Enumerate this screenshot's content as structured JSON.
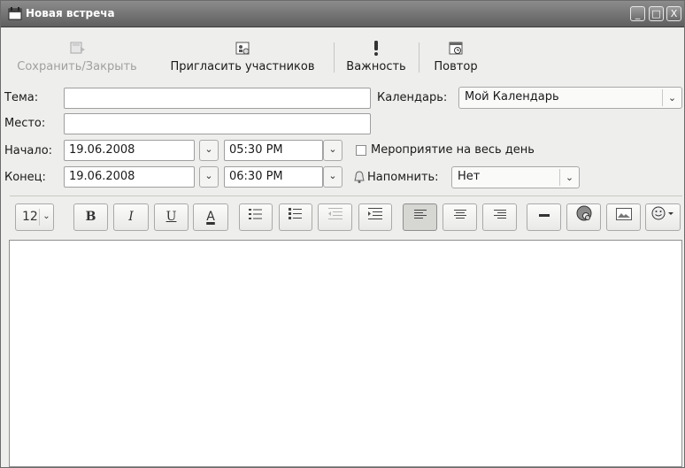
{
  "window": {
    "title": "Новая встреча",
    "controls": [
      "_",
      "□",
      "X"
    ]
  },
  "toolbar": {
    "save_close": "Сохранить/Закрыть",
    "invite": "Пригласить участников",
    "importance": "Важность",
    "repeat": "Повтор"
  },
  "form": {
    "subject_label": "Тема:",
    "subject_value": "",
    "calendar_label": "Календарь:",
    "calendar_value": "Мой Календарь",
    "location_label": "Место:",
    "location_value": "",
    "start_label": "Начало:",
    "start_date": "19.06.2008",
    "start_time": "05:30 PM",
    "allday_label": "Мероприятие на весь день",
    "allday_checked": false,
    "end_label": "Конец:",
    "end_date": "19.06.2008",
    "end_time": "06:30 PM",
    "remind_label": "Напомнить:",
    "remind_value": "Нет"
  },
  "format": {
    "font_size": "12",
    "bold": "B",
    "italic": "I",
    "underline": "U",
    "font_color": "A",
    "icons": [
      "numbered-list-icon",
      "bulleted-list-icon",
      "outdent-icon",
      "indent-icon",
      "align-left-icon",
      "align-center-icon",
      "align-right-icon",
      "horizontal-rule-icon",
      "link-icon",
      "image-icon",
      "smiley-icon"
    ]
  }
}
